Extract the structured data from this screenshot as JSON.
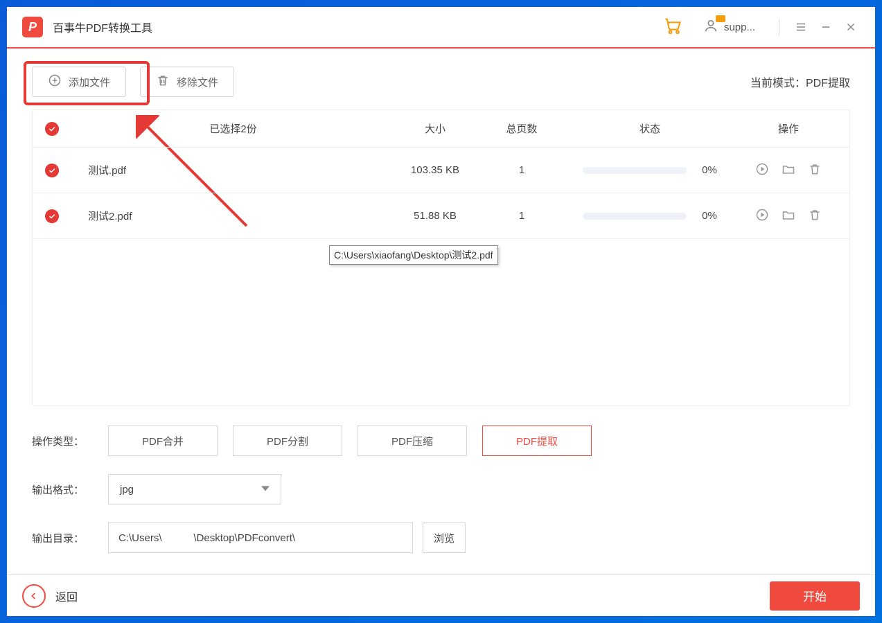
{
  "titlebar": {
    "app_title": "百事牛PDF转换工具",
    "user_label": "supp..."
  },
  "toolbar": {
    "add_file": "添加文件",
    "remove_file": "移除文件",
    "mode_prefix": "当前模式：",
    "mode_value": "PDF提取"
  },
  "table": {
    "headers": {
      "selected": "已选择2份",
      "size": "大小",
      "pages": "总页数",
      "status": "状态",
      "actions": "操作"
    },
    "rows": [
      {
        "name": "测试.pdf",
        "size": "103.35 KB",
        "pages": "1",
        "percent": "0%"
      },
      {
        "name": "测试2.pdf",
        "size": "51.88 KB",
        "pages": "1",
        "percent": "0%"
      }
    ],
    "tooltip": "C:\\Users\\xiaofang\\Desktop\\测试2.pdf"
  },
  "ops": {
    "type_label": "操作类型：",
    "types": [
      "PDF合并",
      "PDF分割",
      "PDF压缩",
      "PDF提取"
    ],
    "active_type_index": 3,
    "format_label": "输出格式：",
    "format_value": "jpg",
    "path_label": "输出目录：",
    "path_value": "C:\\Users\\           \\Desktop\\PDFconvert\\",
    "browse": "浏览"
  },
  "footer": {
    "back": "返回",
    "start": "开始"
  }
}
